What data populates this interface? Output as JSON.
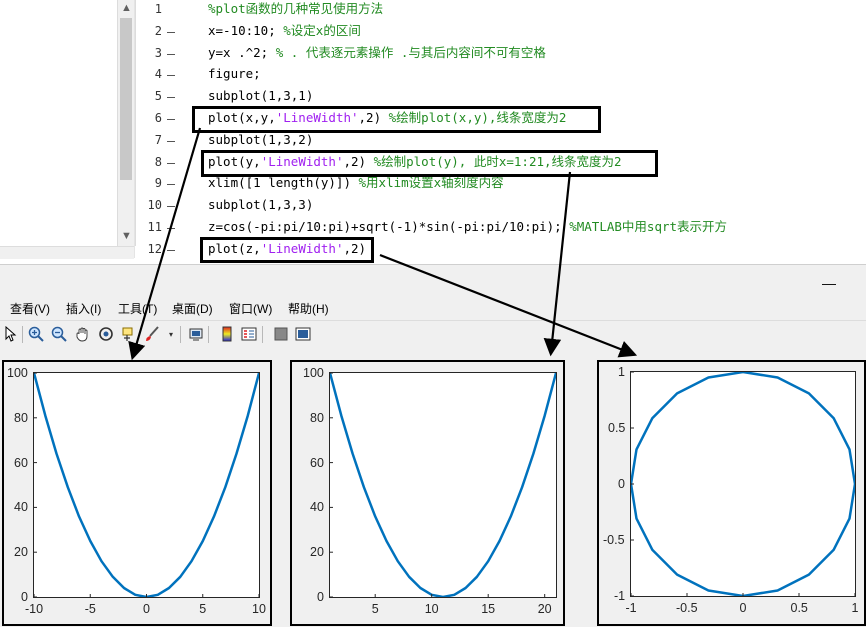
{
  "editor": {
    "lines": [
      {
        "num": "1",
        "code": "",
        "comment": "%plot函数的几种常见使用方法"
      },
      {
        "num": "2",
        "code": "x=-10:10; ",
        "comment": "%设定x的区间"
      },
      {
        "num": "3",
        "code": "y=x .^2; ",
        "comment": "% . 代表逐元素操作 .与其后内容间不可有空格"
      },
      {
        "num": "4",
        "code": "figure;",
        "comment": ""
      },
      {
        "num": "5",
        "code": "subplot(1,3,1)",
        "comment": ""
      },
      {
        "num": "6",
        "code_a": "plot(x,y,",
        "str": "'LineWidth'",
        "code_b": ",2) ",
        "comment": "%绘制plot(x,y),线条宽度为2"
      },
      {
        "num": "7",
        "code": "subplot(1,3,2)",
        "comment": ""
      },
      {
        "num": "8",
        "code_a": "plot(y,",
        "str": "'LineWidth'",
        "code_b": ",2) ",
        "comment": "%绘制plot(y), 此时x=1:21,线条宽度为2"
      },
      {
        "num": "9",
        "code": "xlim([1 length(y)]) ",
        "comment": "%用xlim设置x轴刻度内容"
      },
      {
        "num": "10",
        "code": "subplot(1,3,3)",
        "comment": ""
      },
      {
        "num": "11",
        "code": "z=cos(-pi:pi/10:pi)+sqrt(-1)*sin(-pi:pi/10:pi); ",
        "comment": "%MATLAB中用sqrt表示开方"
      },
      {
        "num": "12",
        "code_a": "plot(z,",
        "str": "'LineWidth'",
        "code_b": ",2)",
        "comment": ""
      }
    ]
  },
  "window": {
    "minimize": "—"
  },
  "menubar": [
    "查看(V)",
    "插入(I)",
    "工具(T)",
    "桌面(D)",
    "窗口(W)",
    "帮助(H)"
  ],
  "toolbar_icons": [
    "pointer-icon",
    "zoom-in-icon",
    "zoom-out-icon",
    "pan-icon",
    "rotate-icon",
    "data-cursor-icon",
    "brush-icon",
    "link-icon",
    "colorbar-icon",
    "legend-icon",
    "hide-plot-tools-icon",
    "show-plot-tools-icon"
  ],
  "colors": {
    "line": "#0072bd",
    "comment": "#228b22",
    "string": "#a020f0"
  },
  "chart_data": [
    {
      "type": "line",
      "x": [
        -10,
        -9,
        -8,
        -7,
        -6,
        -5,
        -4,
        -3,
        -2,
        -1,
        0,
        1,
        2,
        3,
        4,
        5,
        6,
        7,
        8,
        9,
        10
      ],
      "series": [
        {
          "values": [
            100,
            81,
            64,
            49,
            36,
            25,
            16,
            9,
            4,
            1,
            0,
            1,
            4,
            9,
            16,
            25,
            36,
            49,
            64,
            81,
            100
          ]
        }
      ],
      "xlim": [
        -10,
        10
      ],
      "ylim": [
        0,
        100
      ],
      "xticks": [
        "-10",
        "-5",
        "0",
        "5",
        "10"
      ],
      "yticks": [
        "0",
        "20",
        "40",
        "60",
        "80",
        "100"
      ]
    },
    {
      "type": "line",
      "x": [
        1,
        2,
        3,
        4,
        5,
        6,
        7,
        8,
        9,
        10,
        11,
        12,
        13,
        14,
        15,
        16,
        17,
        18,
        19,
        20,
        21
      ],
      "series": [
        {
          "values": [
            100,
            81,
            64,
            49,
            36,
            25,
            16,
            9,
            4,
            1,
            0,
            1,
            4,
            9,
            16,
            25,
            36,
            49,
            64,
            81,
            100
          ]
        }
      ],
      "xlim": [
        1,
        21
      ],
      "ylim": [
        0,
        100
      ],
      "xticks": [
        "5",
        "10",
        "15",
        "20"
      ],
      "yticks": [
        "0",
        "20",
        "40",
        "60",
        "80",
        "100"
      ]
    },
    {
      "type": "line",
      "x": [
        -1,
        -0.951,
        -0.809,
        -0.588,
        -0.309,
        0,
        0.309,
        0.588,
        0.809,
        0.951,
        1,
        0.951,
        0.809,
        0.588,
        0.309,
        0,
        -0.309,
        -0.588,
        -0.809,
        -0.951,
        -1
      ],
      "series": [
        {
          "values": [
            0,
            -0.309,
            -0.588,
            -0.809,
            -0.951,
            -1,
            -0.951,
            -0.809,
            -0.588,
            -0.309,
            0,
            0.309,
            0.588,
            0.809,
            0.951,
            1,
            0.951,
            0.809,
            0.588,
            0.309,
            0
          ]
        }
      ],
      "xlim": [
        -1,
        1
      ],
      "ylim": [
        -1,
        1
      ],
      "xticks": [
        "-1",
        "-0.5",
        "0",
        "0.5",
        "1"
      ],
      "yticks": [
        "-1",
        "-0.5",
        "0",
        "0.5",
        "1"
      ]
    }
  ]
}
